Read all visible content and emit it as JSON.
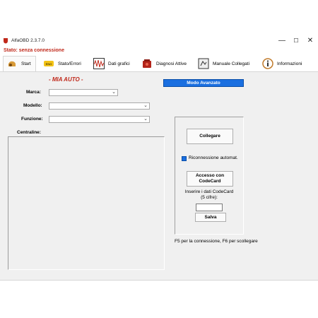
{
  "window": {
    "title": "AlfaOBD 2.3.7.0",
    "controls": {
      "minimize": "—",
      "maximize": "☐",
      "close": "✕"
    }
  },
  "status": {
    "text": "Stato: senza connessione",
    "color": "#c0281a"
  },
  "tabs": [
    {
      "label": "Start",
      "icon": "car-engine-icon",
      "active": true
    },
    {
      "label": "Stato/Errori",
      "icon": "check-engine-icon",
      "active": false
    },
    {
      "label": "Dati grafici",
      "icon": "graph-icon",
      "active": false
    },
    {
      "label": "Diagnosi Attive",
      "icon": "engine-icon",
      "active": false
    },
    {
      "label": "Manuale Collegati",
      "icon": "manual-icon",
      "active": false
    },
    {
      "label": "Informazioni",
      "icon": "info-icon",
      "active": false
    }
  ],
  "main": {
    "section_title": "- MIA AUTO -",
    "marca_label": "Marca:",
    "modello_label": "Modello:",
    "funzione_label": "Funzione:",
    "centraline_label": "Centraline:",
    "marca_value": "",
    "modello_value": "",
    "funzione_value": ""
  },
  "right": {
    "modo_avanzato": "Modo Avanzato",
    "collegare": "Collegare",
    "riconnessione": "Riconnessione automat.",
    "riconnessione_checked": true,
    "accesso_line1": "Accesso con",
    "accesso_line2": "CodeCard",
    "codecard_line1": "Inserire i dati CodeCard",
    "codecard_line2": "(5 cifre):",
    "codecard_value": "",
    "salva": "Salva",
    "hint": "F5 per la connessione, F6 per scollegare"
  },
  "colors": {
    "accent": "#1a6fe0",
    "status": "#c0281a",
    "panel_bg": "#f0f0f0"
  }
}
